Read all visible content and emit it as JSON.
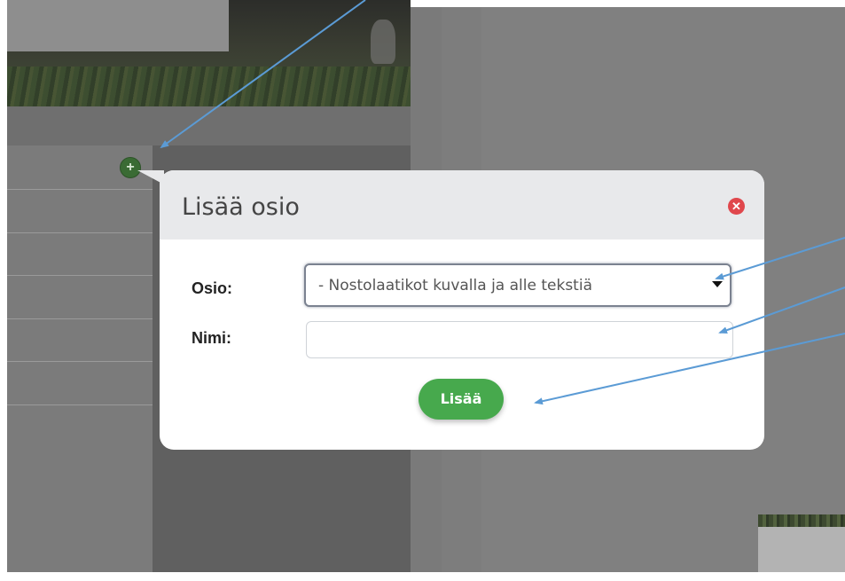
{
  "modal": {
    "title": "Lisää osio",
    "close_icon": "close-circle-icon",
    "osio_label": "Osio:",
    "osio_selected": "- Nostolaatikot kuvalla ja alle tekstiä",
    "nimi_label": "Nimi:",
    "nimi_value": "",
    "submit_label": "Lisää"
  },
  "background": {
    "add_icon": "plus-circle-icon"
  },
  "colors": {
    "header_bg": "#e8e9eb",
    "submit_green": "#47a94d",
    "close_red": "#e0474c",
    "annotation_arrow": "#5b9bd5",
    "overlay_gray": "#7b7b7b"
  }
}
